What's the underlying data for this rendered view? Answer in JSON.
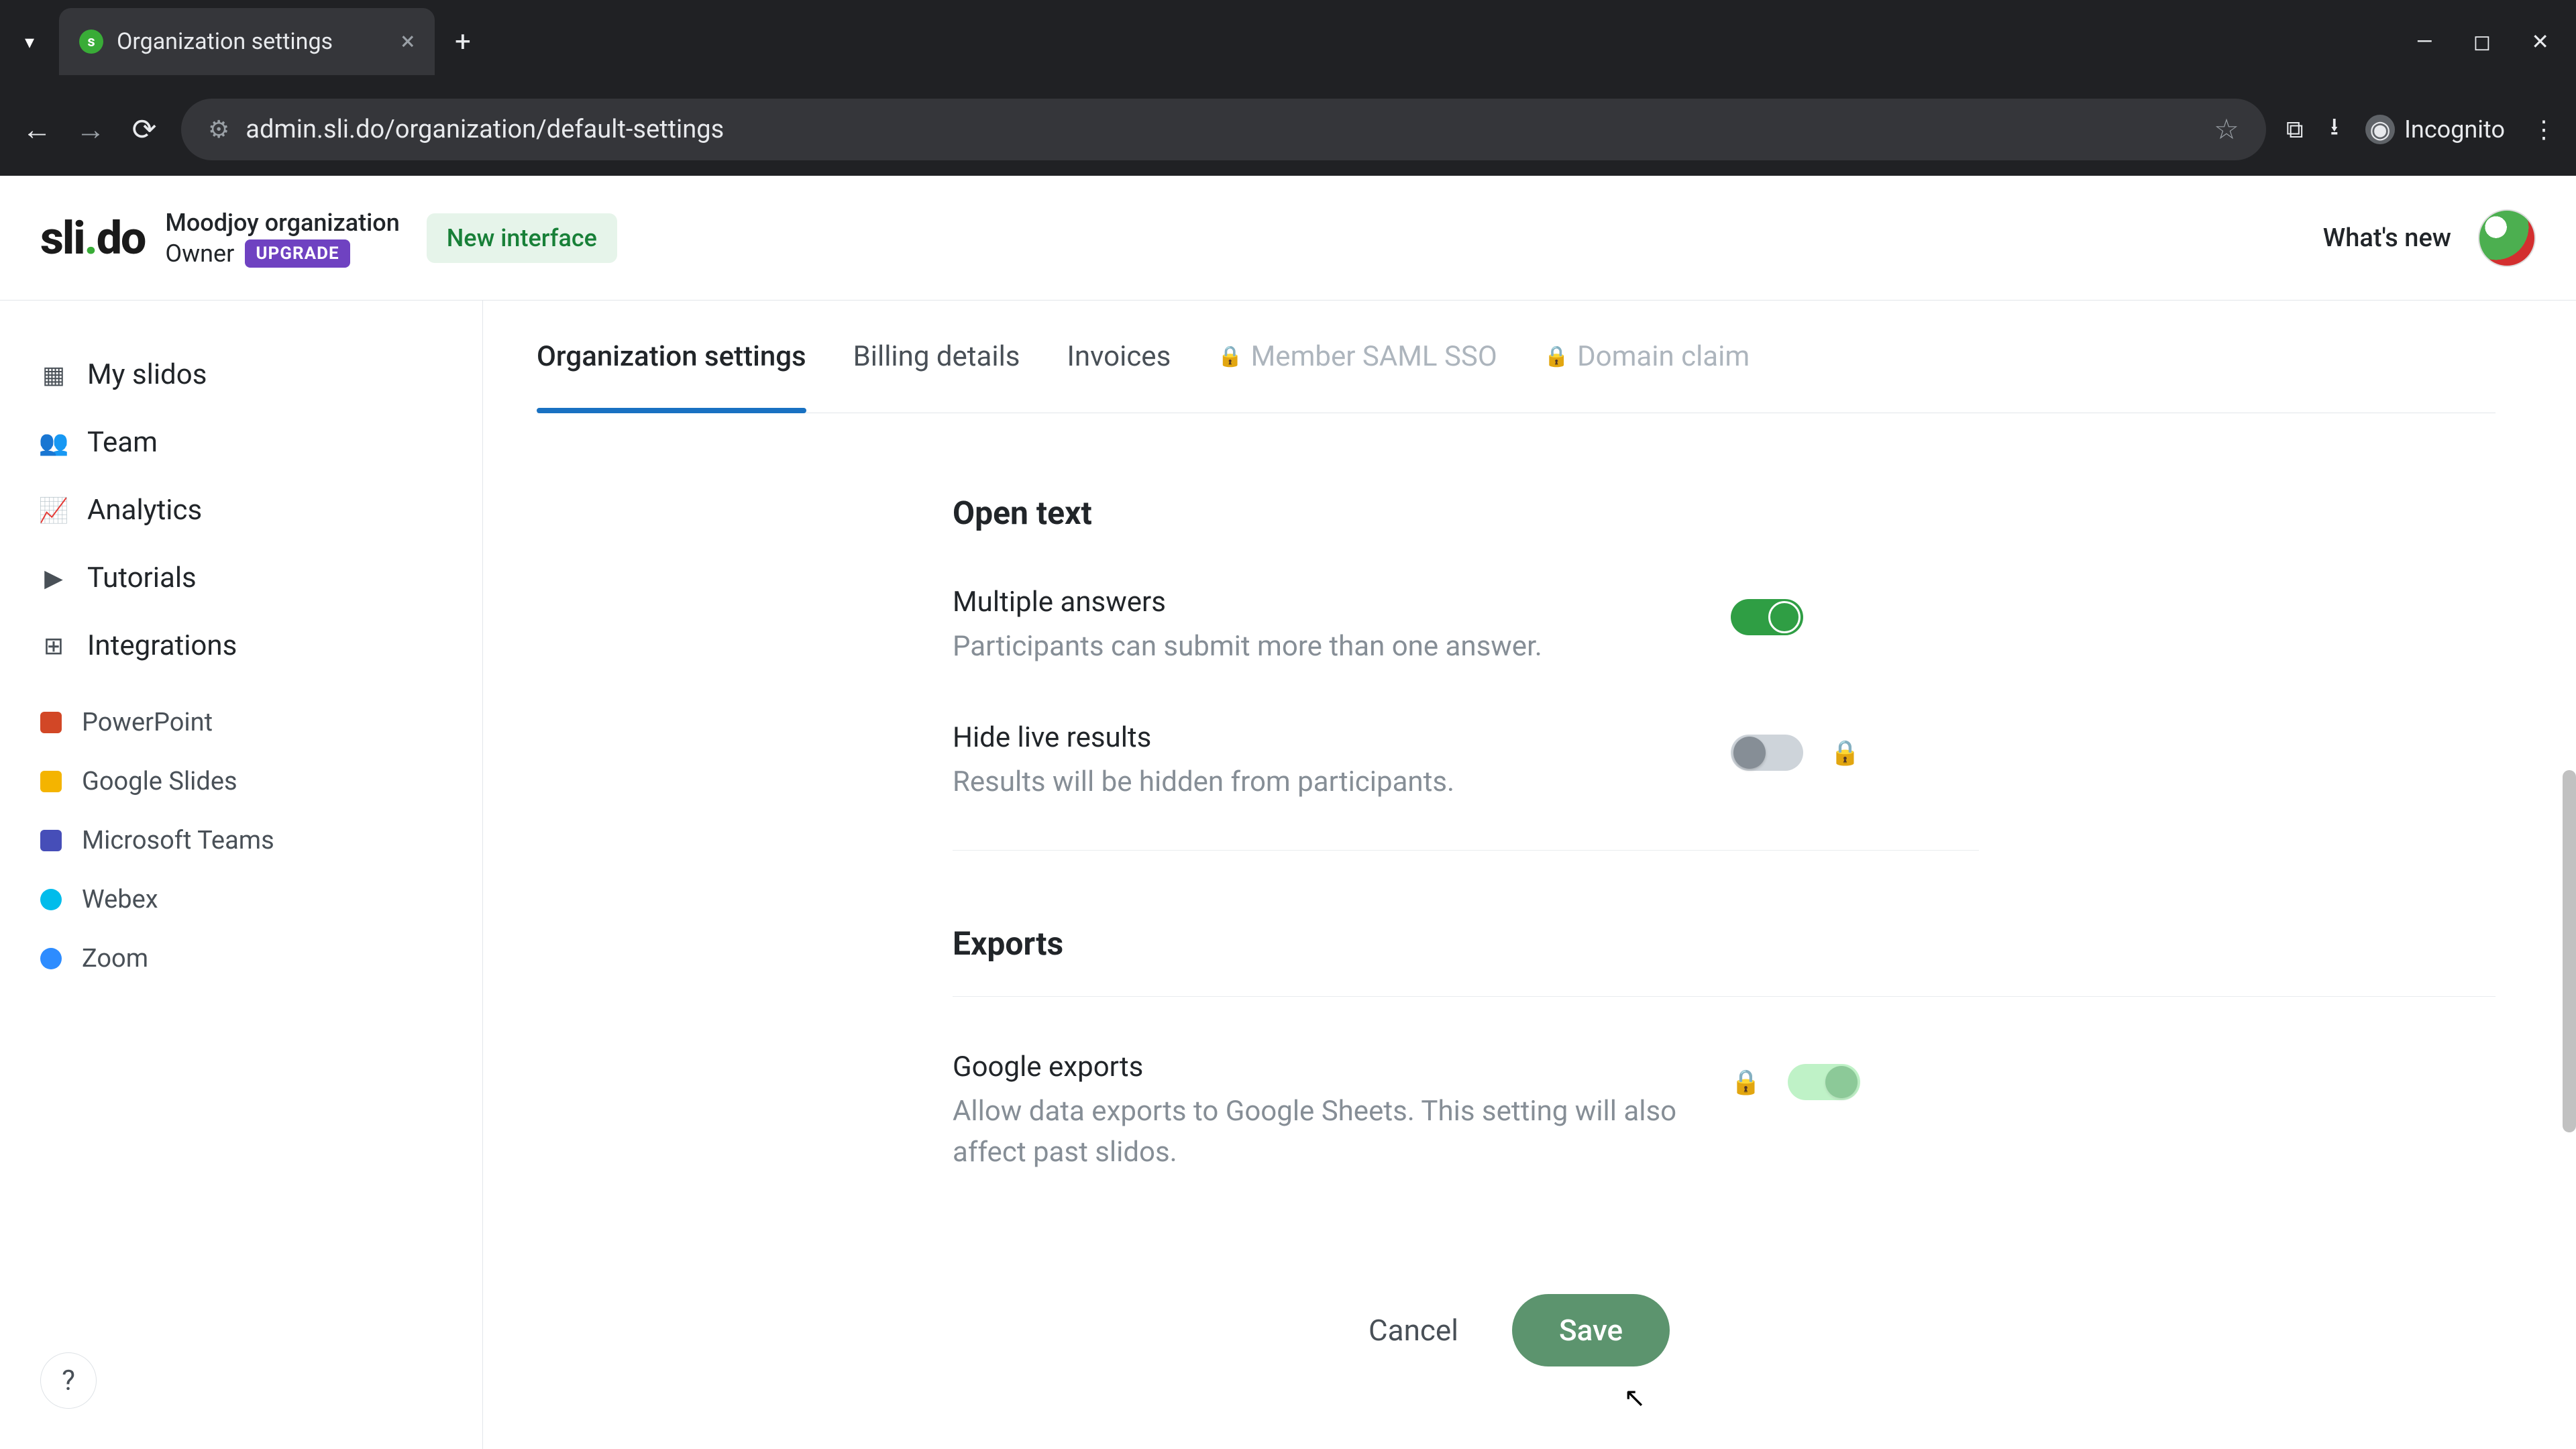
{
  "browser": {
    "tab_title": "Organization settings",
    "url": "admin.sli.do/organization/default-settings",
    "incognito_label": "Incognito"
  },
  "header": {
    "logo_text": "slido",
    "org_name": "Moodjoy organization",
    "role": "Owner",
    "upgrade": "UPGRADE",
    "new_interface": "New interface",
    "whats_new": "What's new"
  },
  "sidebar": {
    "items": [
      {
        "label": "My slidos"
      },
      {
        "label": "Team"
      },
      {
        "label": "Analytics"
      },
      {
        "label": "Tutorials"
      },
      {
        "label": "Integrations"
      }
    ],
    "integrations": [
      {
        "label": "PowerPoint"
      },
      {
        "label": "Google Slides"
      },
      {
        "label": "Microsoft Teams"
      },
      {
        "label": "Webex"
      },
      {
        "label": "Zoom"
      }
    ],
    "help": "?"
  },
  "tabs": [
    {
      "label": "Organization settings"
    },
    {
      "label": "Billing details"
    },
    {
      "label": "Invoices"
    },
    {
      "label": "Member SAML SSO"
    },
    {
      "label": "Domain claim"
    }
  ],
  "sections": {
    "open_text": {
      "heading": "Open text",
      "settings": [
        {
          "title": "Multiple answers",
          "desc": "Participants can submit more than one answer."
        },
        {
          "title": "Hide live results",
          "desc": "Results will be hidden from participants."
        }
      ]
    },
    "exports": {
      "heading": "Exports",
      "settings": [
        {
          "title": "Google exports",
          "desc": "Allow data exports to Google Sheets. This setting will also affect past slidos."
        }
      ]
    }
  },
  "actions": {
    "cancel": "Cancel",
    "save": "Save"
  }
}
